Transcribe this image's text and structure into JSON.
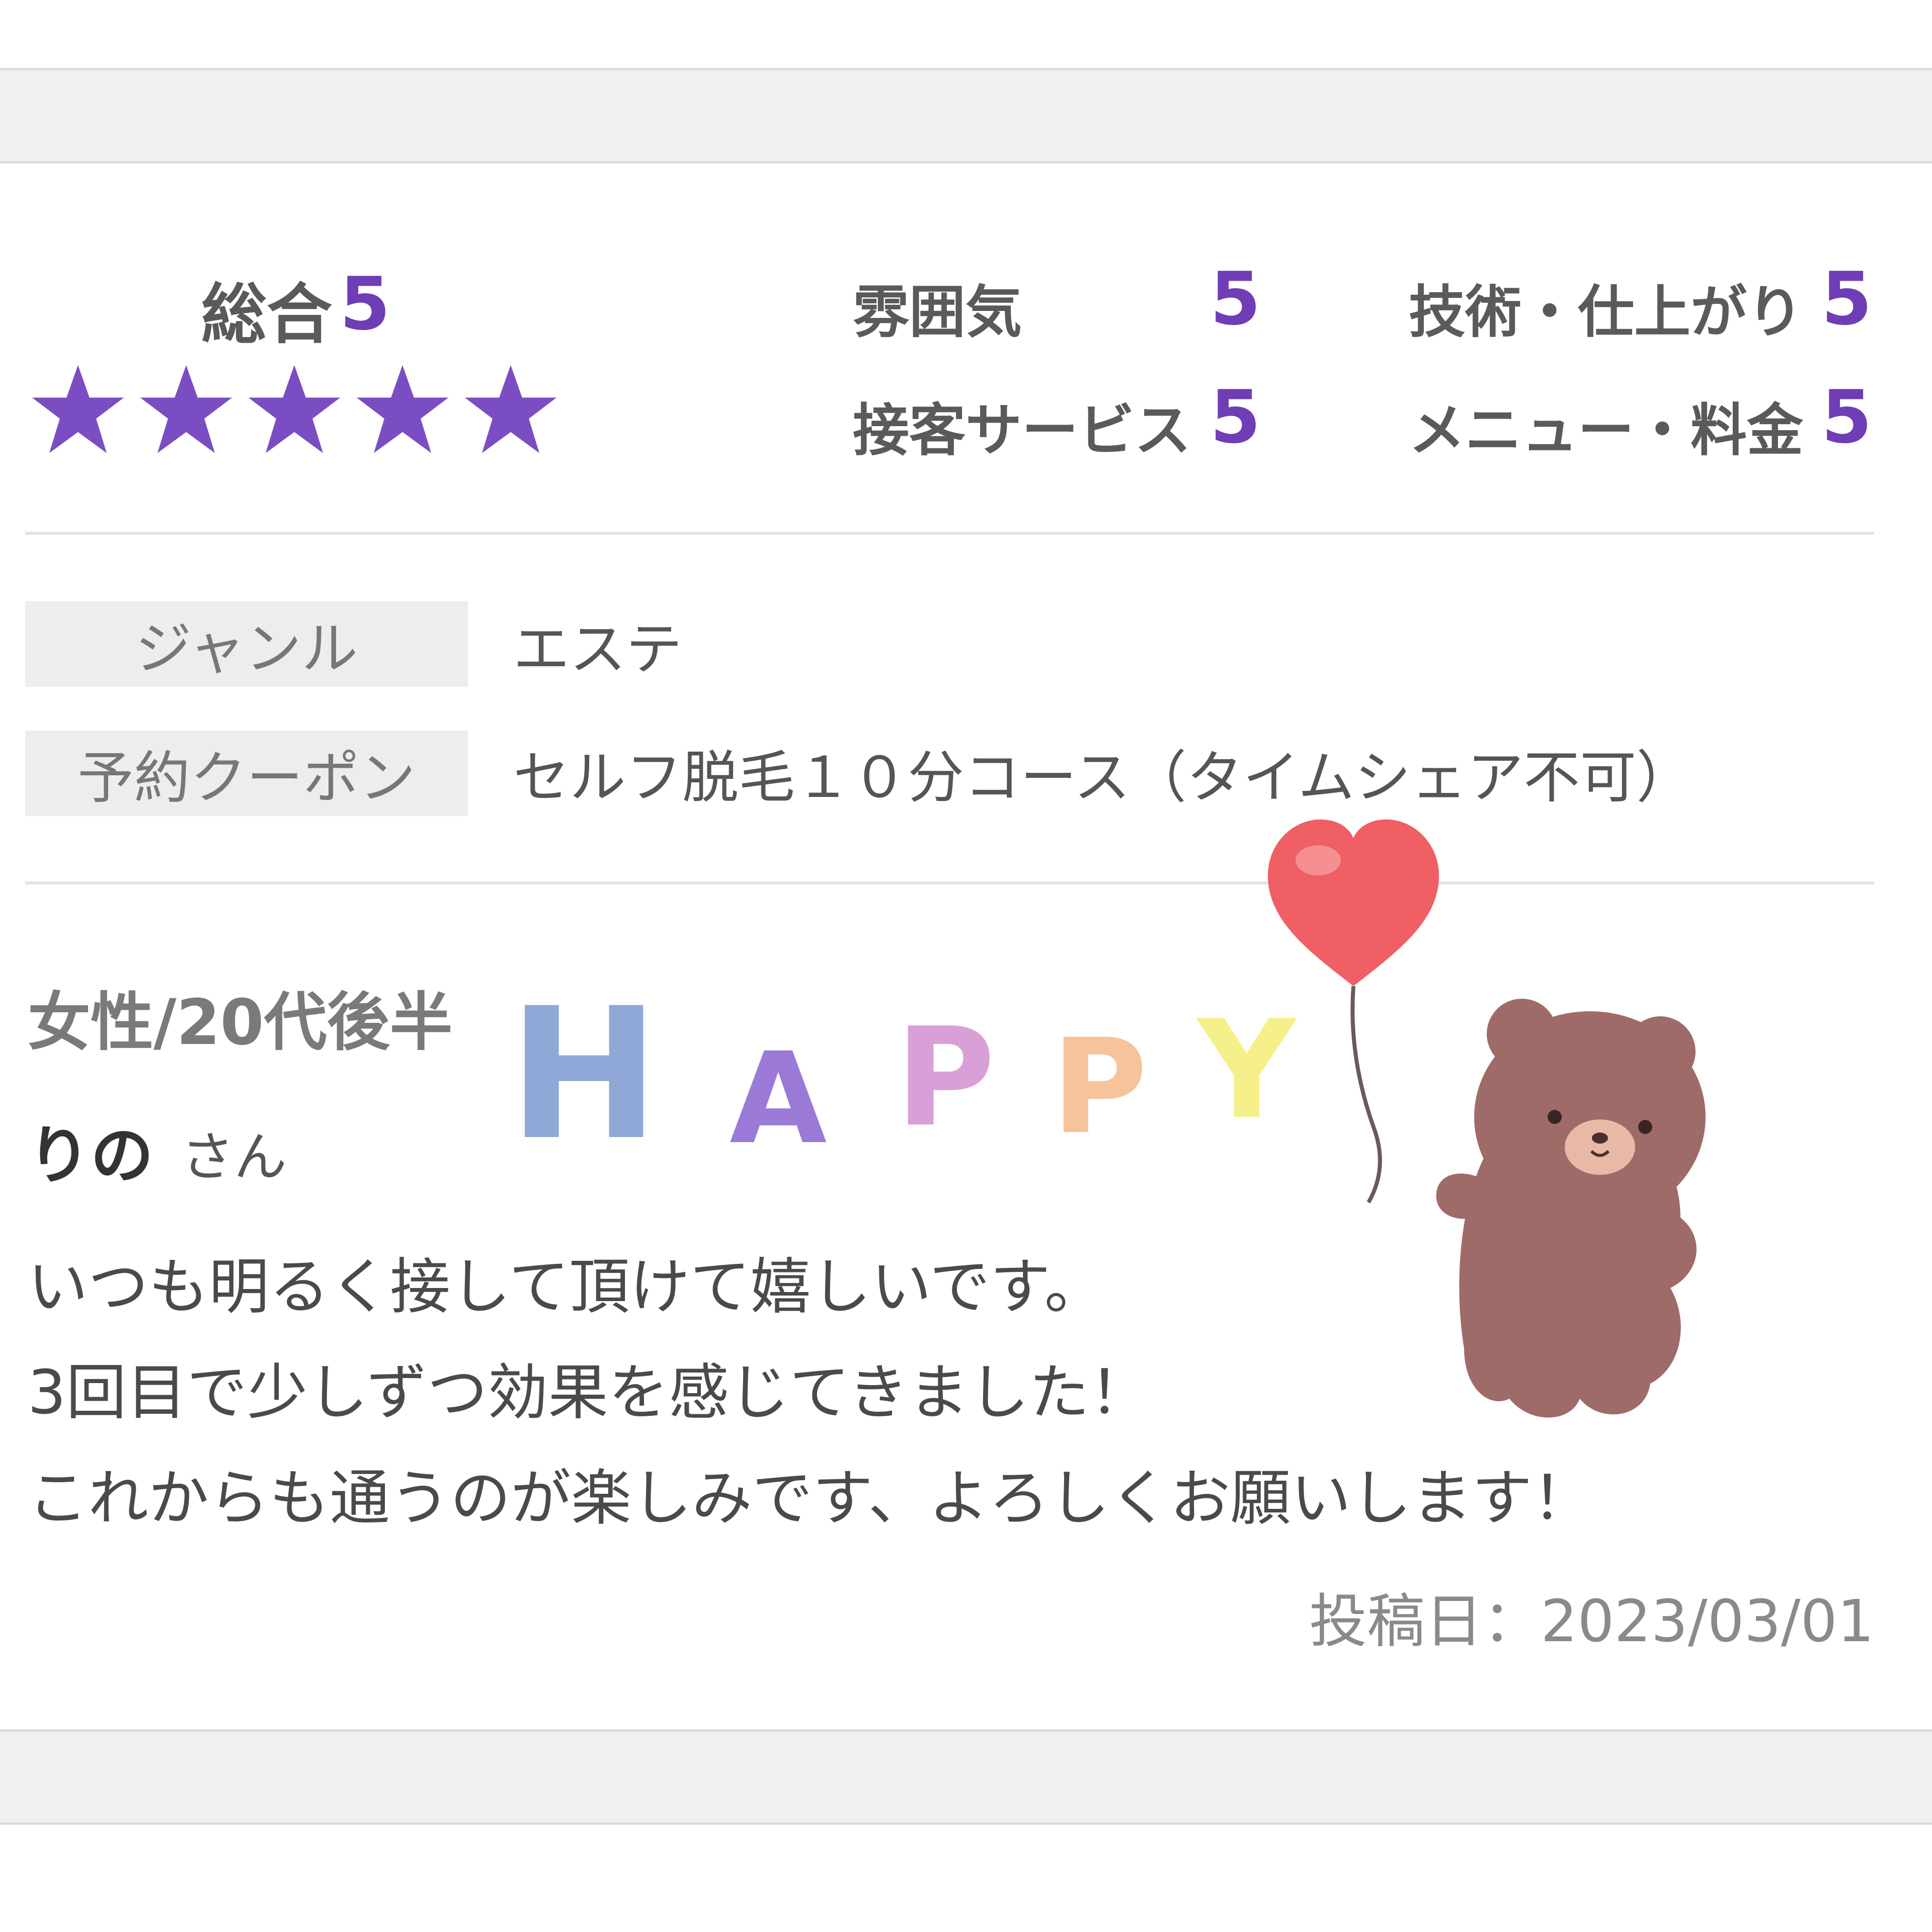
{
  "ratings": {
    "overall_label": "総合",
    "overall_value": "5",
    "overall_stars": 5,
    "star_color": "#7b4dc2",
    "categories": [
      {
        "label": "雰囲気",
        "value": "5"
      },
      {
        "label": "技術・仕上がり",
        "value": "5"
      },
      {
        "label": "接客サービス",
        "value": "5"
      },
      {
        "label": "メニュー・料金",
        "value": "5"
      }
    ]
  },
  "info": {
    "genre_label": "ジャンル",
    "genre_value": "エステ",
    "coupon_label": "予約クーポン",
    "coupon_value": "セルフ脱毛１０分コース（タイムシェア不可）"
  },
  "reviewer": {
    "attributes": "女性/20代後半",
    "name": "りの",
    "honorific": "さん"
  },
  "comment": {
    "lines": [
      "いつも明るく接して頂けて嬉しいです。",
      "3回目で少しずつ効果を感じてきました！",
      "これからも通うのが楽しみです、よろしくお願いします！"
    ]
  },
  "post_date": "投稿日：2023/03/01",
  "stickers": {
    "happy_letters": [
      "H",
      "A",
      "P",
      "P",
      "Y"
    ],
    "happy_colors": [
      "#8fa8d8",
      "#9a7ad6",
      "#d9a0d8",
      "#f5c49a",
      "#f5f08a"
    ],
    "bear_color": "#9e6b69",
    "balloon_color": "#ef5f63"
  }
}
